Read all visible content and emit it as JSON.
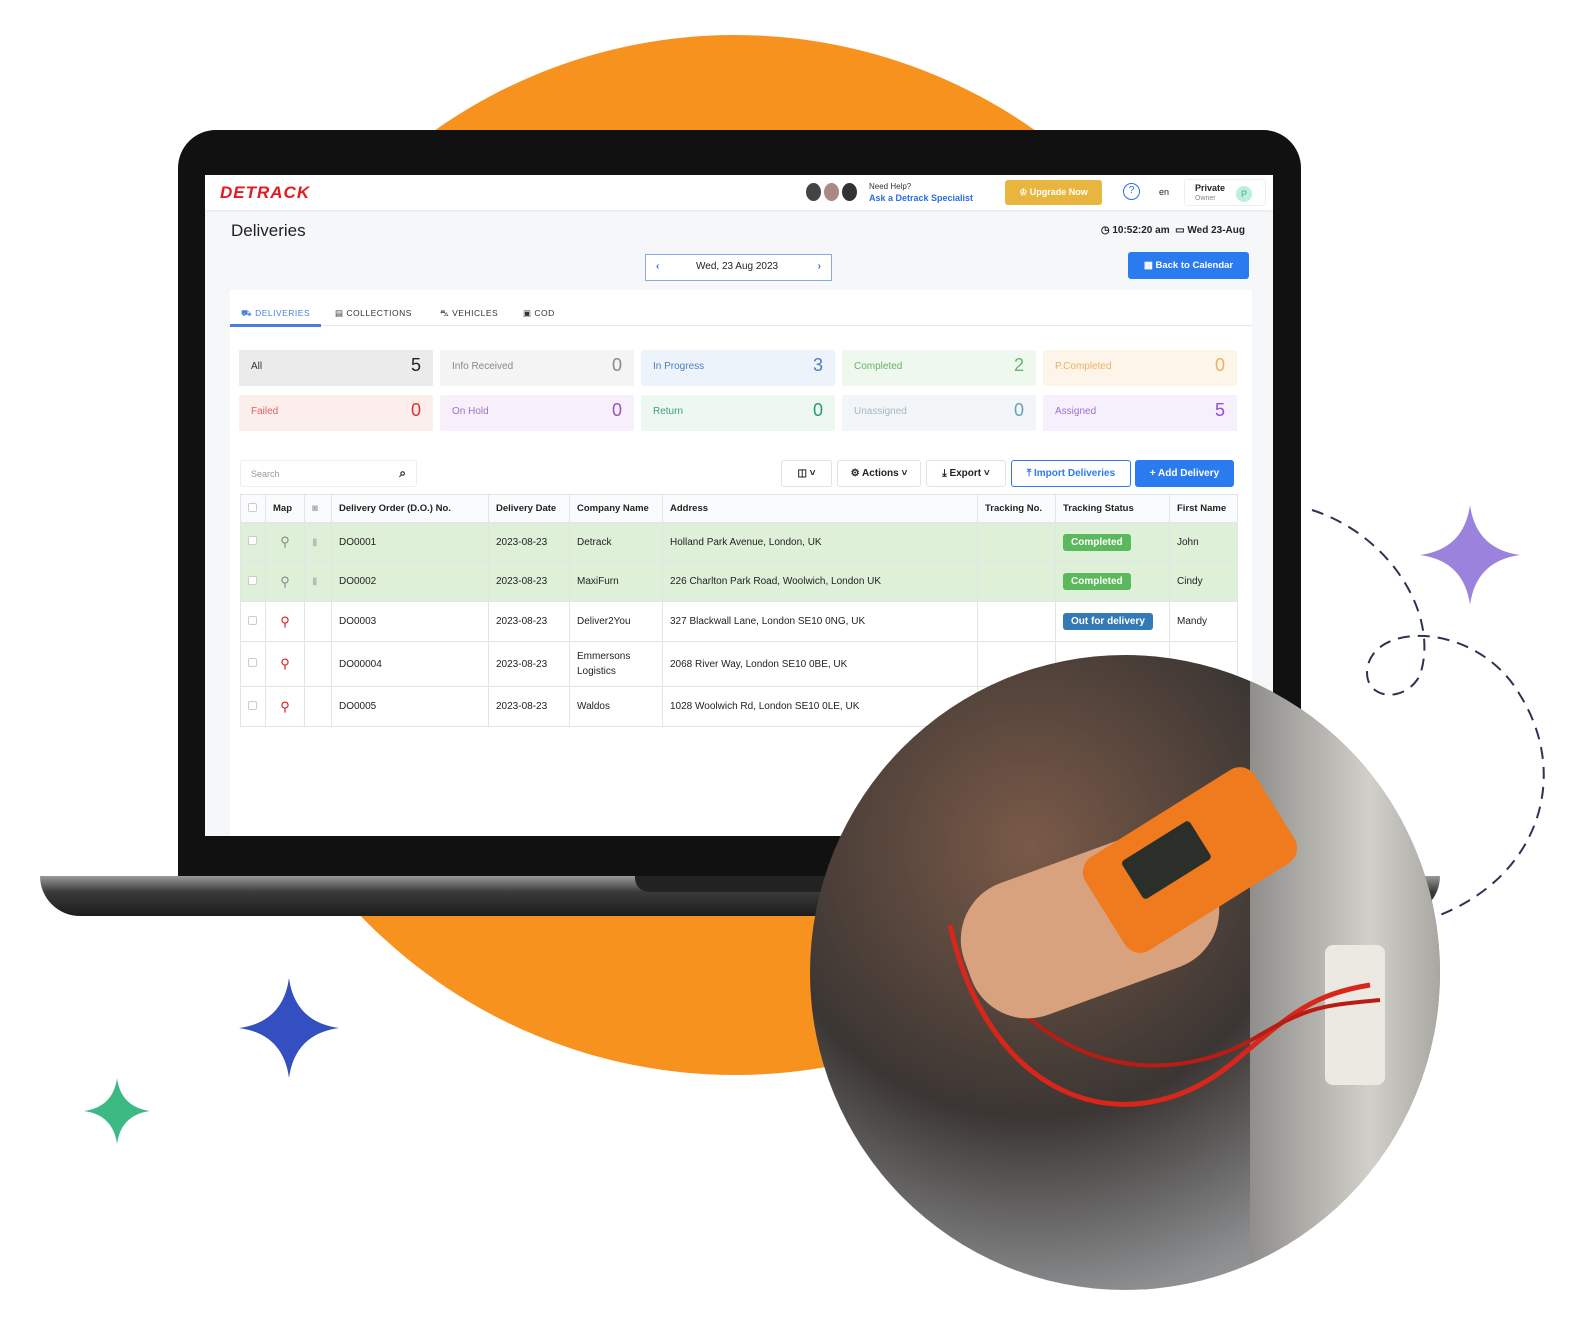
{
  "colors": {
    "brand_orange": "#f7921e",
    "primary_blue": "#2b7bf0",
    "completed_green": "#5cb85c",
    "out_for_delivery_blue": "#337ab7",
    "logo_red": "#e21b23"
  },
  "header": {
    "logo": "DETRACK",
    "help_line1": "Need Help?",
    "help_line2": "Ask a Detrack Specialist",
    "upgrade": "Upgrade Now",
    "help_icon": "?",
    "lang": "en",
    "account_name": "Private",
    "account_role": "Owner",
    "account_initial": "P"
  },
  "page": {
    "title": "Deliveries",
    "time": "10:52:20 am",
    "date": "Wed 23-Aug",
    "nav_date": "Wed, 23 Aug 2023",
    "back_to_calendar": "Back to Calendar"
  },
  "tabs": [
    {
      "label": "DELIVERIES",
      "icon": "truck-icon",
      "active": true
    },
    {
      "label": "COLLECTIONS",
      "icon": "archive-icon"
    },
    {
      "label": "VEHICLES",
      "icon": "car-icon"
    },
    {
      "label": "COD",
      "icon": "money-icon"
    }
  ],
  "stats": [
    {
      "label": "All",
      "value": "5"
    },
    {
      "label": "Info Received",
      "value": "0"
    },
    {
      "label": "In Progress",
      "value": "3"
    },
    {
      "label": "Completed",
      "value": "2"
    },
    {
      "label": "P.Completed",
      "value": "0"
    },
    {
      "label": "Failed",
      "value": "0"
    },
    {
      "label": "On Hold",
      "value": "0"
    },
    {
      "label": "Return",
      "value": "0"
    },
    {
      "label": "Unassigned",
      "value": "0"
    },
    {
      "label": "Assigned",
      "value": "5"
    }
  ],
  "toolbar": {
    "search_placeholder": "Search",
    "actions": "Actions",
    "export": "Export",
    "import": "Import Deliveries",
    "add": "Add Delivery"
  },
  "table": {
    "headers": [
      "Map",
      "Delivery Order (D.O.) No.",
      "Delivery Date",
      "Company Name",
      "Address",
      "Tracking No.",
      "Tracking Status",
      "First Name"
    ],
    "rows": [
      {
        "do": "DO0001",
        "date": "2023-08-23",
        "company": "Detrack",
        "address": "Holland Park Avenue, London, UK",
        "tracking": "",
        "status": "Completed",
        "first": "John"
      },
      {
        "do": "DO0002",
        "date": "2023-08-23",
        "company": "MaxiFurn",
        "address": "226 Charlton Park Road, Woolwich, London UK",
        "tracking": "",
        "status": "Completed",
        "first": "Cindy"
      },
      {
        "do": "DO0003",
        "date": "2023-08-23",
        "company": "Deliver2You",
        "address": "327 Blackwall Lane, London SE10 0NG, UK",
        "tracking": "",
        "status": "Out for delivery",
        "first": "Mandy"
      },
      {
        "do": "DO00004",
        "date": "2023-08-23",
        "company": "Emmersons Logistics",
        "address": "2068 River Way, London SE10 0BE, UK",
        "tracking": "",
        "status": "",
        "first": ""
      },
      {
        "do": "DO0005",
        "date": "2023-08-23",
        "company": "Waldos",
        "address": "1028 Woolwich Rd, London SE10 0LE, UK",
        "tracking": "",
        "status": "",
        "first": ""
      }
    ]
  }
}
